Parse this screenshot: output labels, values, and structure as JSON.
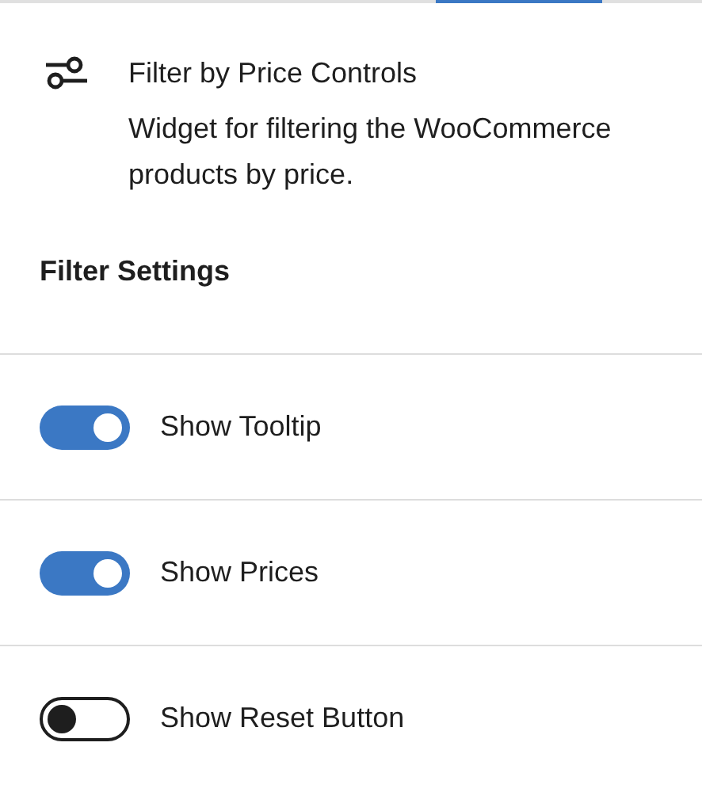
{
  "block": {
    "title": "Filter by Price Controls",
    "description": "Widget for filtering the WooCommerce products by price."
  },
  "section": {
    "title": "Filter Settings"
  },
  "toggles": [
    {
      "label": "Show Tooltip",
      "on": true
    },
    {
      "label": "Show Prices",
      "on": true
    },
    {
      "label": "Show Reset Button",
      "on": false
    }
  ]
}
